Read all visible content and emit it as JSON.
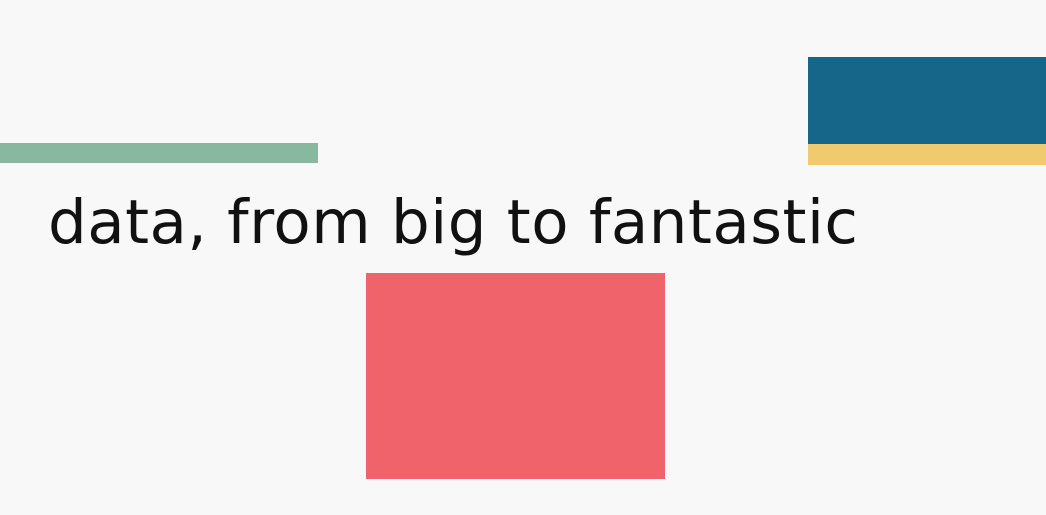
{
  "banner": {
    "tagline": "data, from big to fantastic"
  },
  "colors": {
    "background": "#f8f8f8",
    "green_bar": "#88b9a0",
    "blue_block": "#166689",
    "yellow_bar": "#efcb6e",
    "red_block": "#f0636a",
    "text": "#111111"
  }
}
